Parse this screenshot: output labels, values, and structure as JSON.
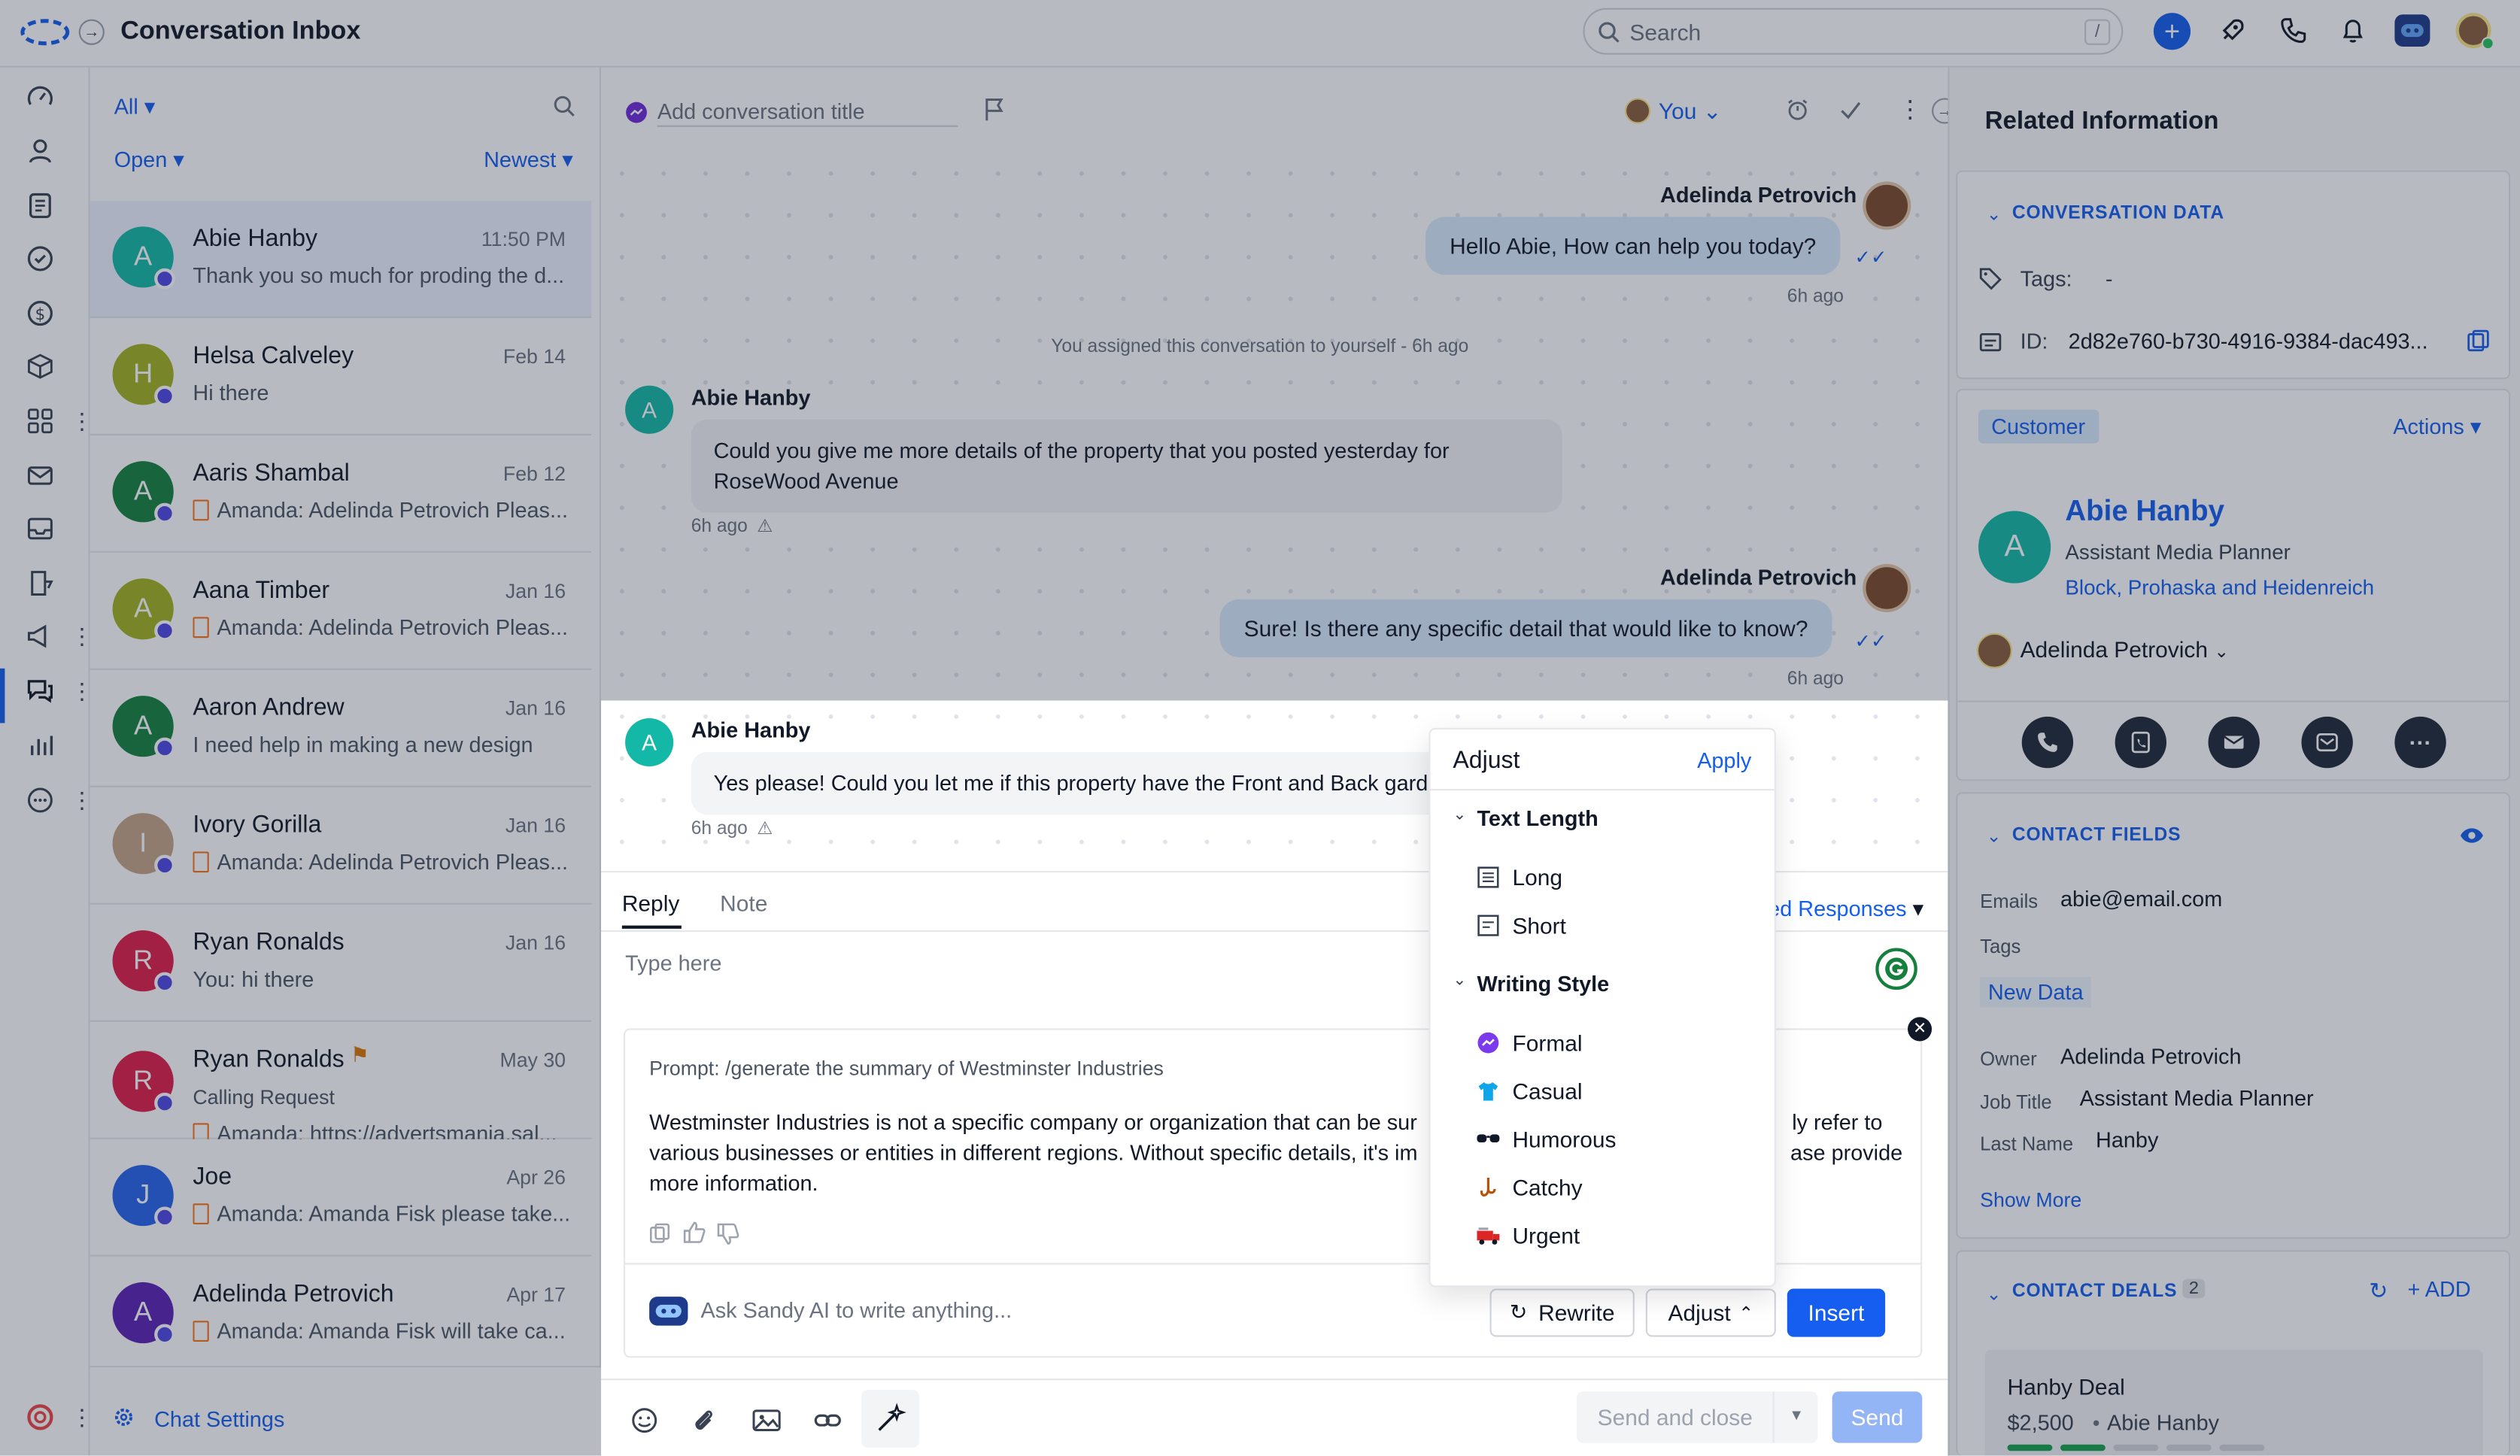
{
  "header": {
    "title": "Conversation Inbox",
    "search_placeholder": "Search",
    "search_shortcut": "/"
  },
  "list": {
    "filter_all": "All",
    "filter_open": "Open",
    "sort": "Newest",
    "items": [
      {
        "initial": "A",
        "name": "Abie Hanby",
        "date": "11:50 PM",
        "preview": "Thank you so much for proding the d...",
        "color": "#14b8a6"
      },
      {
        "initial": "H",
        "name": "Helsa Calveley",
        "date": "Feb 14",
        "preview": "Hi there",
        "color": "#a3b11f"
      },
      {
        "initial": "A",
        "name": "Aaris Shambal",
        "date": "Feb 12",
        "preview": "Amanda: Adelinda Petrovich Pleas...",
        "color": "#15803d"
      },
      {
        "initial": "A",
        "name": "Aana Timber",
        "date": "Jan 16",
        "preview": "Amanda: Adelinda Petrovich Pleas...",
        "color": "#a3b11f"
      },
      {
        "initial": "A",
        "name": "Aaron Andrew",
        "date": "Jan 16",
        "preview": "I need help in making a new design",
        "color": "#15803d"
      },
      {
        "initial": "I",
        "name": "Ivory Gorilla",
        "date": "Jan 16",
        "preview": "Amanda: Adelinda Petrovich Pleas...",
        "color": "#c4a488"
      },
      {
        "initial": "R",
        "name": "Ryan Ronalds",
        "date": "Jan 16",
        "preview": "You: hi there",
        "color": "#e11d48"
      },
      {
        "initial": "R",
        "name": "Ryan Ronalds",
        "date": "May 30",
        "subline": "Calling Request",
        "preview": "Amanda: https://advertsmania.sal...",
        "color": "#e11d48"
      },
      {
        "initial": "J",
        "name": "Joe",
        "date": "Apr 26",
        "preview": "Amanda: Amanda Fisk please take...",
        "color": "#2563eb"
      },
      {
        "initial": "A",
        "name": "Adelinda Petrovich",
        "date": "Apr 17",
        "preview": "Amanda: Amanda Fisk will take ca...",
        "color": "#5b21b6"
      }
    ],
    "chat_settings": "Chat Settings"
  },
  "conversation": {
    "title_placeholder": "Add conversation title",
    "assignee": "You",
    "messages": {
      "m1_sender": "Adelinda Petrovich",
      "m1_text": "Hello Abie, How can help you today?",
      "m1_time": "6h ago",
      "system_note": "You assigned this conversation to yourself - 6h ago",
      "m2_sender": "Abie Hanby",
      "m2_line1": "Could you give me more details of the property that you posted yesterday for",
      "m2_line2": "RoseWood Avenue",
      "m2_time": "6h ago",
      "m3_sender": "Adelinda Petrovich",
      "m3_text": "Sure! Is there any specific detail that would like to know?",
      "m3_time": "6h ago",
      "m4_sender": "Abie Hanby",
      "m4_text": "Yes please! Could you let me if this property have the Front and Back gard",
      "m4_time": "6h ago"
    },
    "composer": {
      "tab_reply": "Reply",
      "tab_note": "Note",
      "responses_label": "ed Responses",
      "placeholder": "Type here",
      "prompt": "Prompt: /generate the summary of Westminster Industries",
      "ai_line1a": "Westminster Industries is not a specific company or organization that can be sur",
      "ai_line1b": "ly refer to",
      "ai_line2a": "various businesses or entities in different regions. Without specific details, it's im",
      "ai_line2b": "ase provide",
      "ai_line3": "more information.",
      "ask_placeholder": "Ask Sandy AI to write anything...",
      "rewrite": "Rewrite",
      "adjust": "Adjust",
      "insert": "Insert",
      "send_close": "Send and close",
      "send": "Send"
    }
  },
  "adjust_menu": {
    "title": "Adjust",
    "apply": "Apply",
    "text_length_header": "Text Length",
    "long": "Long",
    "short": "Short",
    "writing_style_header": "Writing Style",
    "formal": "Formal",
    "casual": "Casual",
    "humorous": "Humorous",
    "catchy": "Catchy",
    "urgent": "Urgent"
  },
  "related": {
    "title": "Related Information",
    "conversation_data": "CONVERSATION DATA",
    "tags_label": "Tags:",
    "tags_value": "-",
    "id_label": "ID:",
    "id_value": "2d82e760-b730-4916-9384-dac493...",
    "customer_badge": "Customer",
    "actions": "Actions",
    "contact_initial": "A",
    "contact_name": "Abie Hanby",
    "contact_title": "Assistant Media Planner",
    "contact_company": "Block, Prohaska and Heidenreich",
    "owner_name": "Adelinda Petrovich",
    "contact_fields": "CONTACT FIELDS",
    "emails_label": "Emails",
    "emails_value": "abie@email.com",
    "tags_field_label": "Tags",
    "tag_new_data": "New Data",
    "owner_label": "Owner",
    "owner_value": "Adelinda Petrovich",
    "job_title_label": "Job Title",
    "job_title_value": "Assistant Media Planner",
    "last_name_label": "Last Name",
    "last_name_value": "Hanby",
    "show_more": "Show More",
    "contact_deals": "CONTACT DEALS",
    "deals_count": "2",
    "add": "ADD",
    "deal_name": "Hanby Deal",
    "deal_amount": "$2,500",
    "deal_contact": "Abie Hanby"
  }
}
